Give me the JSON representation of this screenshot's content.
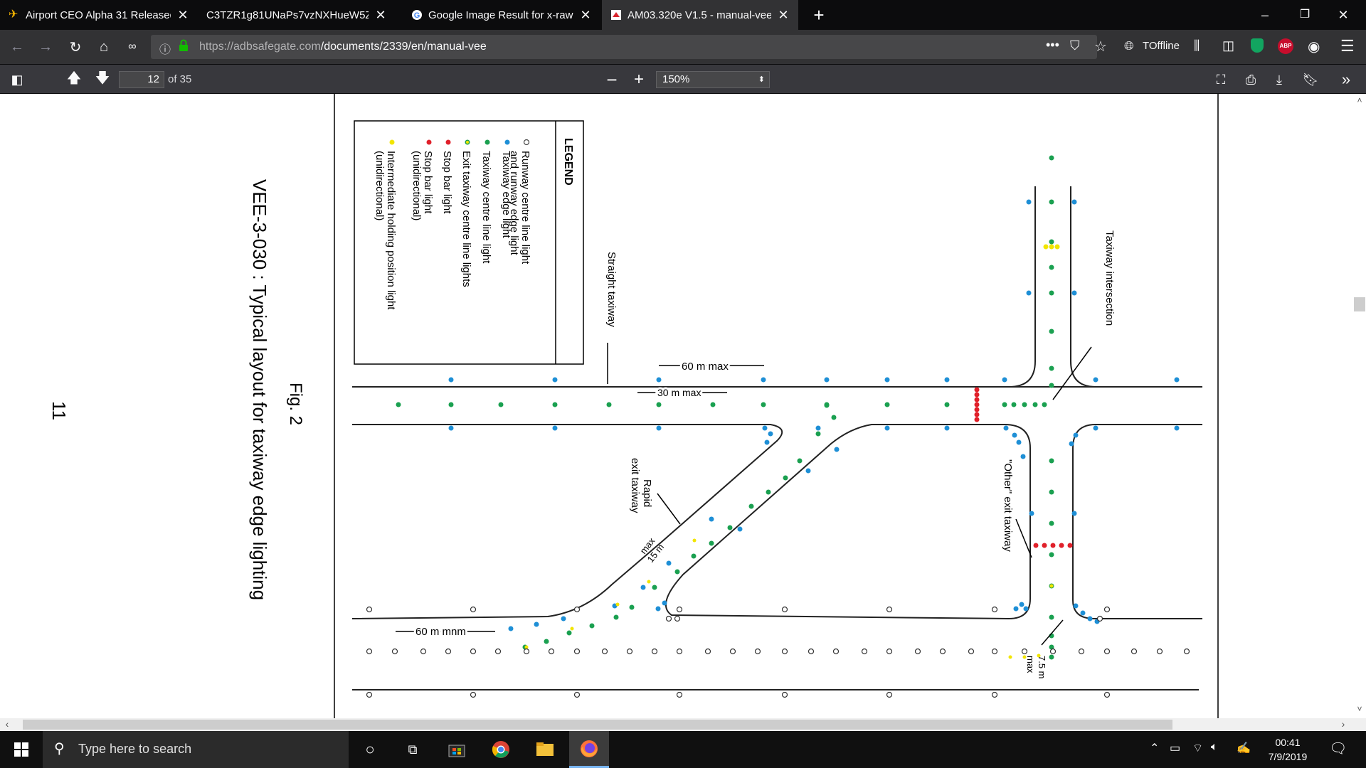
{
  "tabs": [
    {
      "title": "Airport CEO Alpha 31 Released",
      "icon": "airplane-icon"
    },
    {
      "title": "C3TZR1g81UNaPs7vzNXHueW5ZM",
      "icon": ""
    },
    {
      "title": "Google Image Result for x-raw",
      "icon": "google-icon"
    },
    {
      "title": "AM03.320e V1.5 - manual-vee",
      "icon": "pdf-icon",
      "active": true
    }
  ],
  "url": {
    "host": "https://adbsafegate.com",
    "path": "/documents/2339/en/manual-vee"
  },
  "nav": {
    "offline_label": "TOffline",
    "abp_label": "ABP"
  },
  "pdf_toolbar": {
    "page_number": "12",
    "page_count": "of 35",
    "zoom": "150%"
  },
  "figure": {
    "legend_title": "LEGEND",
    "legend_items": [
      {
        "label": "Runway centre line light",
        "label2": "and runway edge light",
        "color": "#ffffff",
        "stroke": "#444444"
      },
      {
        "label": "Taxiway edge light",
        "color": "#1e8fd6"
      },
      {
        "label": "Taxiway centre line light",
        "color": "#1aa050"
      },
      {
        "label": "Exit taxiway centre line lights",
        "color": "#1aa050",
        "color2": "#f2e500"
      },
      {
        "label": "Stop bar light",
        "color": "#e0202a"
      },
      {
        "label": "Stop bar light",
        "label2": "(unidirectional)",
        "color": "#e0202a"
      },
      {
        "label": "Intermediate holding position light",
        "label2": "(unidirectional)",
        "color": "#f2e500"
      }
    ],
    "labels": {
      "straight_taxiway": "Straight taxiway",
      "taxiway_intersection": "Taxiway intersection",
      "rapid_exit_1": "Rapid",
      "rapid_exit_2": "exit taxiway",
      "other_exit": "\"Other\" exit taxiway",
      "dim_60_max": "60 m max",
      "dim_30_max": "30 m max",
      "dim_15_max": "15 m",
      "dim_15_max2": "max",
      "dim_60_mnm": "60 m mnm",
      "dim_7_5": "7.5 m",
      "dim_7_5b": "max"
    },
    "fig_number": "Fig. 2",
    "caption": "VEE-3-030 : Typical layout for taxiway edge lighting",
    "page_number": "11"
  },
  "taskbar": {
    "search_placeholder": "Type here to search",
    "time": "00:41",
    "date": "7/9/2019"
  },
  "colors": {
    "taxiway_edge": "#1e8fd6",
    "centre_line": "#1aa050",
    "stop_bar": "#e0202a",
    "holding": "#f2e500"
  }
}
